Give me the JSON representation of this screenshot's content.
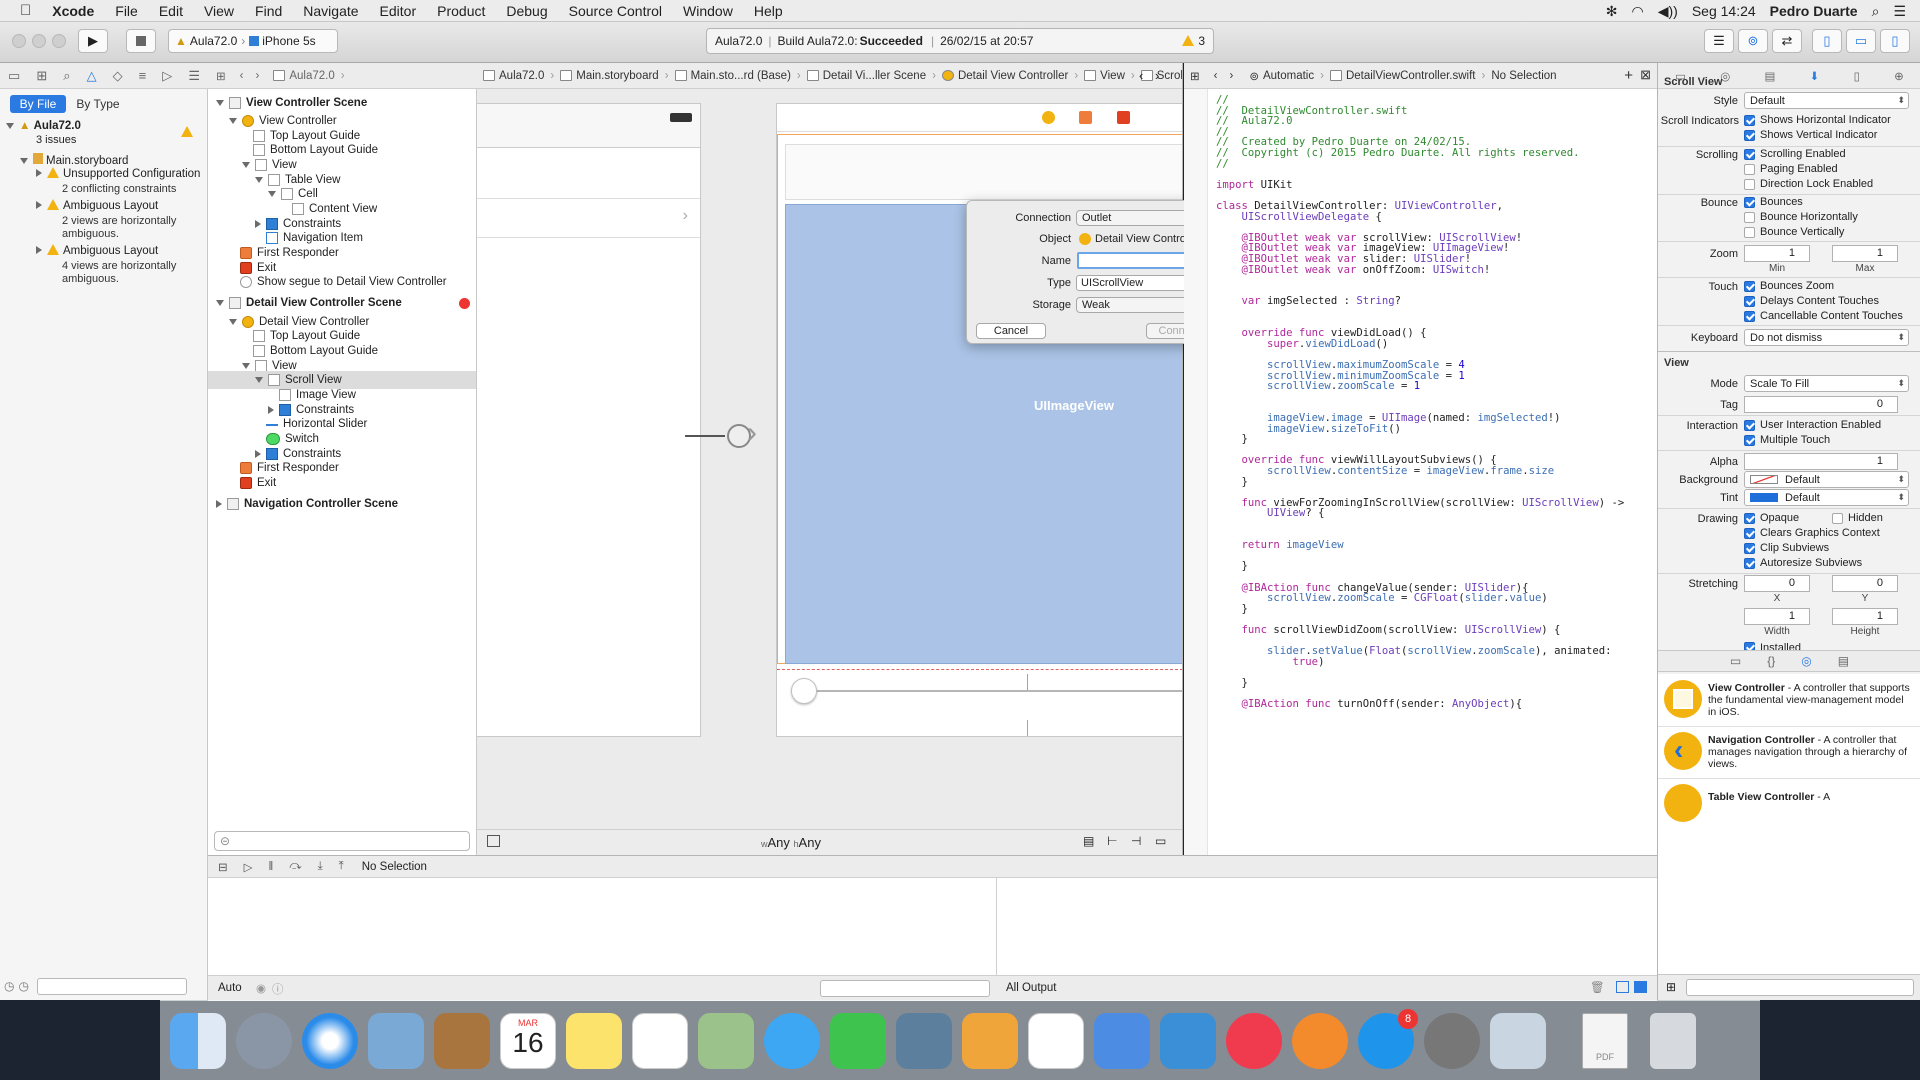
{
  "menubar": {
    "app": "Xcode",
    "items": [
      "File",
      "Edit",
      "View",
      "Find",
      "Navigate",
      "Editor",
      "Product",
      "Debug",
      "Source Control",
      "Window",
      "Help"
    ],
    "clock": "Seg 14:24",
    "user": "Pedro Duarte"
  },
  "toolbar": {
    "scheme": "Aula72.0",
    "device": "iPhone 5s",
    "activity_project": "Aula72.0",
    "activity_build": "Build Aula72.0:",
    "activity_status": "Succeeded",
    "activity_date": "26/02/15 at 20:57",
    "warnings": "3"
  },
  "navigator": {
    "filter_tabs": [
      "By File",
      "By Type"
    ],
    "project": "Aula72.0",
    "project_sub": "3 issues",
    "storyboard": "Main.storyboard",
    "issues": [
      {
        "title": "Unsupported Configuration",
        "detail": "2 conflicting constraints"
      },
      {
        "title": "Ambiguous Layout",
        "detail": "2 views are horizontally ambiguous."
      },
      {
        "title": "Ambiguous Layout",
        "detail": "4 views are horizontally ambiguous."
      }
    ]
  },
  "jumpbar": {
    "items": [
      "Aula72.0",
      "Aula72.0",
      "Main.storyboard",
      "Main.sto...rd (Base)",
      "Detail Vi...ller Scene",
      "Detail View Controller",
      "View",
      "Scroll View"
    ]
  },
  "outline": {
    "rows": [
      {
        "t": "View Controller Scene"
      },
      {
        "t": "View Controller"
      },
      {
        "t": "Top Layout Guide"
      },
      {
        "t": "Bottom Layout Guide"
      },
      {
        "t": "View"
      },
      {
        "t": "Table View"
      },
      {
        "t": "Cell"
      },
      {
        "t": "Content View"
      },
      {
        "t": "Constraints"
      },
      {
        "t": "Navigation Item"
      },
      {
        "t": "First Responder"
      },
      {
        "t": "Exit"
      },
      {
        "t": "Show segue to Detail View Controller"
      },
      {
        "t": "Detail View Controller Scene"
      },
      {
        "t": "Detail View Controller"
      },
      {
        "t": "Top Layout Guide"
      },
      {
        "t": "Bottom Layout Guide"
      },
      {
        "t": "View"
      },
      {
        "t": "Scroll View"
      },
      {
        "t": "Image View"
      },
      {
        "t": "Constraints"
      },
      {
        "t": "Horizontal Slider"
      },
      {
        "t": "Switch"
      },
      {
        "t": "Constraints"
      },
      {
        "t": "First Responder"
      },
      {
        "t": "Exit"
      },
      {
        "t": "Navigation Controller Scene"
      }
    ]
  },
  "canvas": {
    "image_view_label": "UIImageView",
    "size_w": "Any",
    "size_h": "Any",
    "size_w_prefix": "w",
    "size_h_prefix": "h"
  },
  "popover": {
    "connection_label": "Connection",
    "connection_value": "Outlet",
    "object_label": "Object",
    "object_value": "Detail View Controller",
    "name_label": "Name",
    "name_value": "",
    "type_label": "Type",
    "type_value": "UIScrollView",
    "storage_label": "Storage",
    "storage_value": "Weak",
    "cancel": "Cancel",
    "connect": "Connect"
  },
  "assistant": {
    "mode": "Automatic",
    "file": "DetailViewController.swift",
    "selection": "No Selection"
  },
  "code": [
    [
      [
        "cm",
        "//"
      ]
    ],
    [
      [
        "cm",
        "//  DetailViewController.swift"
      ]
    ],
    [
      [
        "cm",
        "//  Aula72.0"
      ]
    ],
    [
      [
        "cm",
        "//"
      ]
    ],
    [
      [
        "cm",
        "//  Created by Pedro Duarte on 24/02/15."
      ]
    ],
    [
      [
        "cm",
        "//  Copyright (c) 2015 Pedro Duarte. All rights reserved."
      ]
    ],
    [
      [
        "cm",
        "//"
      ]
    ],
    [],
    [
      [
        "kw",
        "import"
      ],
      [
        "df",
        " UIKit"
      ]
    ],
    [],
    [
      [
        "kw",
        "class"
      ],
      [
        "df",
        " DetailViewController: "
      ],
      [
        "ty",
        "UIViewController"
      ],
      [
        "df",
        ","
      ]
    ],
    [
      [
        "df",
        "    "
      ],
      [
        "ty",
        "UIScrollViewDelegate"
      ],
      [
        "df",
        " {"
      ]
    ],
    [],
    [
      [
        "df",
        "    "
      ],
      [
        "kw",
        "@IBOutlet weak var"
      ],
      [
        "df",
        " scrollView: "
      ],
      [
        "ty",
        "UIScrollView"
      ],
      [
        "df",
        "!"
      ]
    ],
    [
      [
        "df",
        "    "
      ],
      [
        "kw",
        "@IBOutlet weak var"
      ],
      [
        "df",
        " imageView: "
      ],
      [
        "ty",
        "UIImageView"
      ],
      [
        "df",
        "!"
      ]
    ],
    [
      [
        "df",
        "    "
      ],
      [
        "kw",
        "@IBOutlet weak var"
      ],
      [
        "df",
        " slider: "
      ],
      [
        "ty",
        "UISlider"
      ],
      [
        "df",
        "!"
      ]
    ],
    [
      [
        "df",
        "    "
      ],
      [
        "kw",
        "@IBOutlet weak var"
      ],
      [
        "df",
        " onOffZoom: "
      ],
      [
        "ty",
        "UISwitch"
      ],
      [
        "df",
        "!"
      ]
    ],
    [],
    [],
    [
      [
        "df",
        "    "
      ],
      [
        "kw",
        "var"
      ],
      [
        "df",
        " imgSelected : "
      ],
      [
        "ty",
        "String"
      ],
      [
        "df",
        "?"
      ]
    ],
    [],
    [],
    [
      [
        "df",
        "    "
      ],
      [
        "kw",
        "override func"
      ],
      [
        "df",
        " viewDidLoad() {"
      ]
    ],
    [
      [
        "df",
        "        "
      ],
      [
        "kw",
        "super"
      ],
      [
        "df",
        "."
      ],
      [
        "pr",
        "viewDidLoad"
      ],
      [
        "df",
        "()"
      ]
    ],
    [],
    [
      [
        "df",
        "        "
      ],
      [
        "pr",
        "scrollView"
      ],
      [
        "df",
        "."
      ],
      [
        "pr",
        "maximumZoomScale"
      ],
      [
        "df",
        " = "
      ],
      [
        "nu",
        "4"
      ]
    ],
    [
      [
        "df",
        "        "
      ],
      [
        "pr",
        "scrollView"
      ],
      [
        "df",
        "."
      ],
      [
        "pr",
        "minimumZoomScale"
      ],
      [
        "df",
        " = "
      ],
      [
        "nu",
        "1"
      ]
    ],
    [
      [
        "df",
        "        "
      ],
      [
        "pr",
        "scrollView"
      ],
      [
        "df",
        "."
      ],
      [
        "pr",
        "zoomScale"
      ],
      [
        "df",
        " = "
      ],
      [
        "nu",
        "1"
      ]
    ],
    [],
    [],
    [
      [
        "df",
        "        "
      ],
      [
        "pr",
        "imageView"
      ],
      [
        "df",
        "."
      ],
      [
        "pr",
        "image"
      ],
      [
        "df",
        " = "
      ],
      [
        "ty",
        "UIImage"
      ],
      [
        "df",
        "(named: "
      ],
      [
        "pr",
        "imgSelected"
      ],
      [
        "df",
        "!)"
      ]
    ],
    [
      [
        "df",
        "        "
      ],
      [
        "pr",
        "imageView"
      ],
      [
        "df",
        "."
      ],
      [
        "pr",
        "sizeToFit"
      ],
      [
        "df",
        "()"
      ]
    ],
    [
      [
        "df",
        "    }"
      ]
    ],
    [],
    [
      [
        "df",
        "    "
      ],
      [
        "kw",
        "override func"
      ],
      [
        "df",
        " viewWillLayoutSubviews() {"
      ]
    ],
    [
      [
        "df",
        "        "
      ],
      [
        "pr",
        "scrollView"
      ],
      [
        "df",
        "."
      ],
      [
        "pr",
        "contentSize"
      ],
      [
        "df",
        " = "
      ],
      [
        "pr",
        "imageView"
      ],
      [
        "df",
        "."
      ],
      [
        "pr",
        "frame"
      ],
      [
        "df",
        "."
      ],
      [
        "pr",
        "size"
      ]
    ],
    [
      [
        "df",
        "    }"
      ]
    ],
    [],
    [
      [
        "df",
        "    "
      ],
      [
        "kw",
        "func"
      ],
      [
        "df",
        " viewForZoomingInScrollView(scrollView: "
      ],
      [
        "ty",
        "UIScrollView"
      ],
      [
        "df",
        ") ->"
      ]
    ],
    [
      [
        "df",
        "        "
      ],
      [
        "ty",
        "UIView"
      ],
      [
        "df",
        "? {"
      ]
    ],
    [],
    [],
    [
      [
        "df",
        "    "
      ],
      [
        "kw",
        "return"
      ],
      [
        "df",
        " "
      ],
      [
        "pr",
        "imageView"
      ]
    ],
    [],
    [
      [
        "df",
        "    }"
      ]
    ],
    [],
    [
      [
        "df",
        "    "
      ],
      [
        "kw",
        "@IBAction func"
      ],
      [
        "df",
        " changeValue(sender: "
      ],
      [
        "ty",
        "UISlider"
      ],
      [
        "df",
        "){"
      ]
    ],
    [
      [
        "df",
        "        "
      ],
      [
        "pr",
        "scrollView"
      ],
      [
        "df",
        "."
      ],
      [
        "pr",
        "zoomScale"
      ],
      [
        "df",
        " = "
      ],
      [
        "ty",
        "CGFloat"
      ],
      [
        "df",
        "("
      ],
      [
        "pr",
        "slider"
      ],
      [
        "df",
        "."
      ],
      [
        "pr",
        "value"
      ],
      [
        "df",
        ")"
      ]
    ],
    [
      [
        "df",
        "    }"
      ]
    ],
    [],
    [
      [
        "df",
        "    "
      ],
      [
        "kw",
        "func"
      ],
      [
        "df",
        " scrollViewDidZoom(scrollView: "
      ],
      [
        "ty",
        "UIScrollView"
      ],
      [
        "df",
        ") {"
      ]
    ],
    [],
    [
      [
        "df",
        "        "
      ],
      [
        "pr",
        "slider"
      ],
      [
        "df",
        "."
      ],
      [
        "pr",
        "setValue"
      ],
      [
        "df",
        "("
      ],
      [
        "ty",
        "Float"
      ],
      [
        "df",
        "("
      ],
      [
        "pr",
        "scrollView"
      ],
      [
        "df",
        "."
      ],
      [
        "pr",
        "zoomScale"
      ],
      [
        "df",
        "), animated:"
      ]
    ],
    [
      [
        "df",
        "            "
      ],
      [
        "kw",
        "true"
      ],
      [
        "df",
        ")"
      ]
    ],
    [],
    [
      [
        "df",
        "    }"
      ]
    ],
    [],
    [
      [
        "df",
        "    "
      ],
      [
        "kw",
        "@IBAction func"
      ],
      [
        "df",
        " turnOnOff(sender: "
      ],
      [
        "ty",
        "AnyObject"
      ],
      [
        "df",
        "){"
      ]
    ]
  ],
  "inspector": {
    "scroll_section": "Scroll View",
    "style_label": "Style",
    "style_value": "Default",
    "indicators_label": "Scroll Indicators",
    "show_h": "Shows Horizontal Indicator",
    "show_v": "Shows Vertical Indicator",
    "scrolling_label": "Scrolling",
    "scroll_enabled": "Scrolling Enabled",
    "paging": "Paging Enabled",
    "dir_lock": "Direction Lock Enabled",
    "bounce_label": "Bounce",
    "bounces": "Bounces",
    "bounce_h": "Bounce Horizontally",
    "bounce_v": "Bounce Vertically",
    "zoom_label": "Zoom",
    "zoom_min": "1",
    "zoom_max": "1",
    "min_label": "Min",
    "max_label": "Max",
    "touch_label": "Touch",
    "bounces_zoom": "Bounces Zoom",
    "delays": "Delays Content Touches",
    "cancellable": "Cancellable Content Touches",
    "keyboard_label": "Keyboard",
    "keyboard_value": "Do not dismiss",
    "view_section": "View",
    "mode_label": "Mode",
    "mode_value": "Scale To Fill",
    "tag_label": "Tag",
    "tag_value": "0",
    "interaction_label": "Interaction",
    "user_interaction": "User Interaction Enabled",
    "multi_touch": "Multiple Touch",
    "alpha_label": "Alpha",
    "alpha_value": "1",
    "background_label": "Background",
    "background_value": "Default",
    "tint_label": "Tint",
    "tint_value": "Default",
    "drawing_label": "Drawing",
    "opaque": "Opaque",
    "hidden": "Hidden",
    "clears": "Clears Graphics Context",
    "clip": "Clip Subviews",
    "autoresize": "Autoresize Subviews",
    "stretching_label": "Stretching",
    "stretch_x": "0",
    "stretch_y": "0",
    "stretch_w": "1",
    "stretch_h": "1",
    "x_label": "X",
    "y_label": "Y",
    "w_label": "Width",
    "h_label": "Height",
    "installed": "Installed",
    "library": [
      {
        "title": "View Controller",
        "desc": " - A controller that supports the fundamental view-management model in iOS."
      },
      {
        "title": "Navigation Controller",
        "desc": " - A controller that manages navigation through a hierarchy of views."
      },
      {
        "title": "Table View Controller",
        "desc": " - A"
      }
    ]
  },
  "debug": {
    "no_selection": "No Selection",
    "auto": "Auto",
    "all_output": "All Output"
  },
  "dock": {
    "calendar_month": "MAR",
    "calendar_day": "16",
    "appstore_badge": "8",
    "doc_label": "PDF"
  }
}
